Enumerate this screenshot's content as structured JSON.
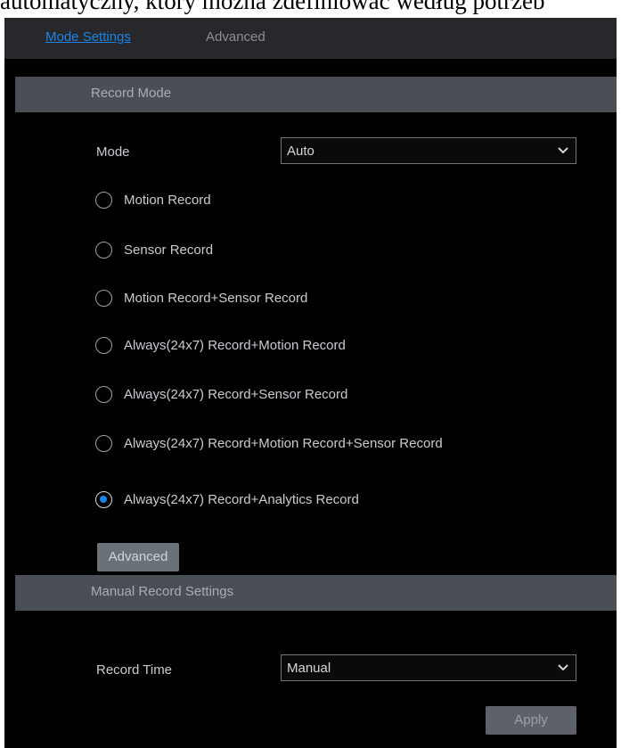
{
  "doc_text": "automatyczny, który można zdefiniować według potrzeb",
  "tabs": [
    {
      "label": "Mode Settings"
    },
    {
      "label": "Advanced"
    }
  ],
  "record_mode": {
    "section_title": "Record Mode",
    "mode_label": "Mode",
    "mode_value": "Auto",
    "options": [
      {
        "label": "Motion Record",
        "selected": false
      },
      {
        "label": "Sensor Record",
        "selected": false
      },
      {
        "label": "Motion Record+Sensor Record",
        "selected": false
      },
      {
        "label": "Always(24x7) Record+Motion Record",
        "selected": false
      },
      {
        "label": "Always(24x7) Record+Sensor Record",
        "selected": false
      },
      {
        "label": "Always(24x7) Record+Motion Record+Sensor Record",
        "selected": false
      },
      {
        "label": "Always(24x7) Record+Analytics Record",
        "selected": true
      }
    ],
    "advanced_button": "Advanced"
  },
  "manual_record": {
    "section_title": "Manual Record Settings",
    "record_time_label": "Record Time",
    "record_time_value": "Manual"
  },
  "apply_button": "Apply",
  "colors": {
    "accent": "#1e84e6",
    "panel_bg": "#000000",
    "tabbar_bg": "#26282c",
    "section_bg": "#4a4f55",
    "button_bg": "#6a7177"
  }
}
